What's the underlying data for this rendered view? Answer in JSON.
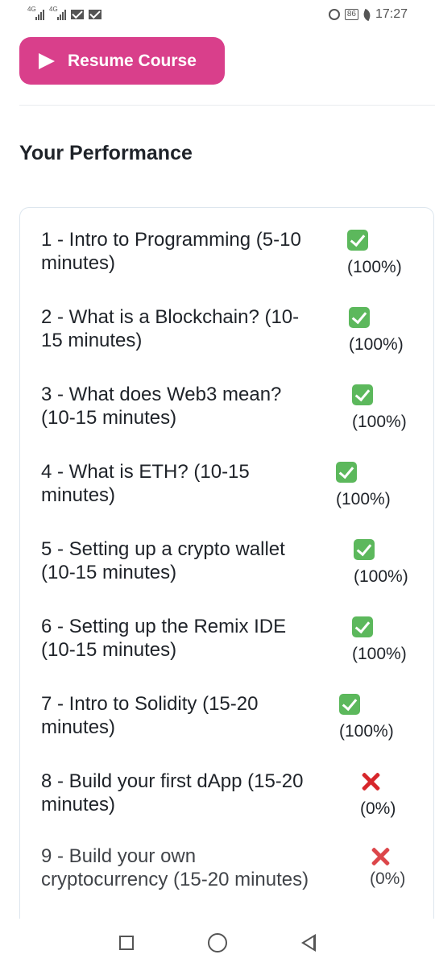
{
  "status_bar": {
    "network_1": "4G",
    "network_2": "4G",
    "battery": "86",
    "time": "17:27"
  },
  "resume_button": {
    "label": "Resume Course"
  },
  "section_title": "Your Performance",
  "lessons": [
    {
      "title_l1": "1 - Intro to Programming (5-10",
      "title_l2": "minutes)",
      "status": "check",
      "percent": "(100%)"
    },
    {
      "title_l1": "2 - What is a Blockchain? (10-",
      "title_l2": "15 minutes)",
      "status": "check",
      "percent": "(100%)"
    },
    {
      "title_l1": "3 - What does Web3 mean?",
      "title_l2": "(10-15 minutes)",
      "status": "check",
      "percent": "(100%)"
    },
    {
      "title_l1": "4 - What is ETH? (10-15",
      "title_l2": "minutes)",
      "status": "check",
      "percent": "(100%)"
    },
    {
      "title_l1": "5 - Setting up a crypto wallet",
      "title_l2": "(10-15 minutes)",
      "status": "check",
      "percent": "(100%)"
    },
    {
      "title_l1": "6 - Setting up the Remix IDE",
      "title_l2": "(10-15 minutes)",
      "status": "check",
      "percent": "(100%)"
    },
    {
      "title_l1": "7 - Intro to Solidity (15-20",
      "title_l2": "minutes)",
      "status": "check",
      "percent": "(100%)"
    },
    {
      "title_l1": "8 - Build your first dApp (15-20",
      "title_l2": "minutes)",
      "status": "cross",
      "percent": "(0%)"
    },
    {
      "title_l1": "9 - Build your own",
      "title_l2": "cryptocurrency (15-20 minutes)",
      "status": "cross",
      "percent": "(0%)"
    }
  ]
}
